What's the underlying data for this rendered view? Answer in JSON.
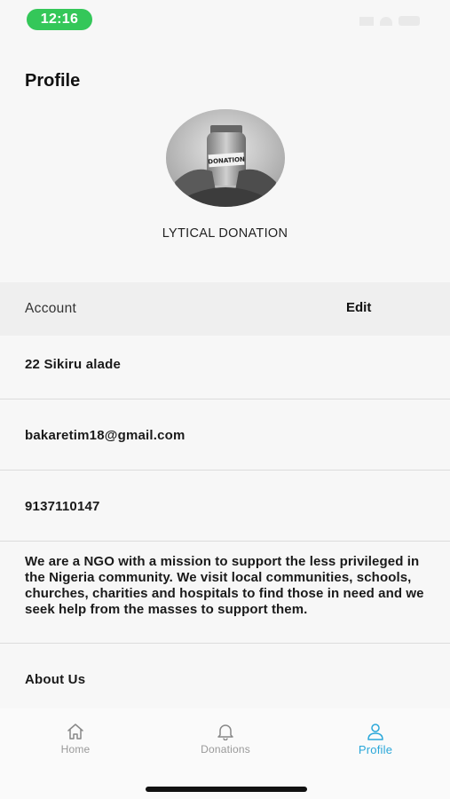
{
  "status_bar": {
    "time": "12:16"
  },
  "header": {
    "title": "Profile"
  },
  "profile": {
    "org_name": "LYTICAL DONATION",
    "avatar_jar_label": "DONATION"
  },
  "account": {
    "label": "Account",
    "edit_label": "Edit"
  },
  "details": {
    "address": "22 Sikiru alade",
    "email": "bakaretim18@gmail.com",
    "phone": "9137110147",
    "about": "We are a NGO with a mission to support the less privileged in the Nigeria community. We visit local communities, schools, churches, charities and hospitals to find those in need and we seek help from the masses to support them.",
    "about_us_label": "About Us"
  },
  "tabs": [
    {
      "label": "Home",
      "icon": "home-icon",
      "active": false
    },
    {
      "label": "Donations",
      "icon": "bell-icon",
      "active": false
    },
    {
      "label": "Profile",
      "icon": "person-icon",
      "active": true
    }
  ],
  "colors": {
    "accent": "#2aa7d9",
    "time_pill": "#34c759"
  }
}
